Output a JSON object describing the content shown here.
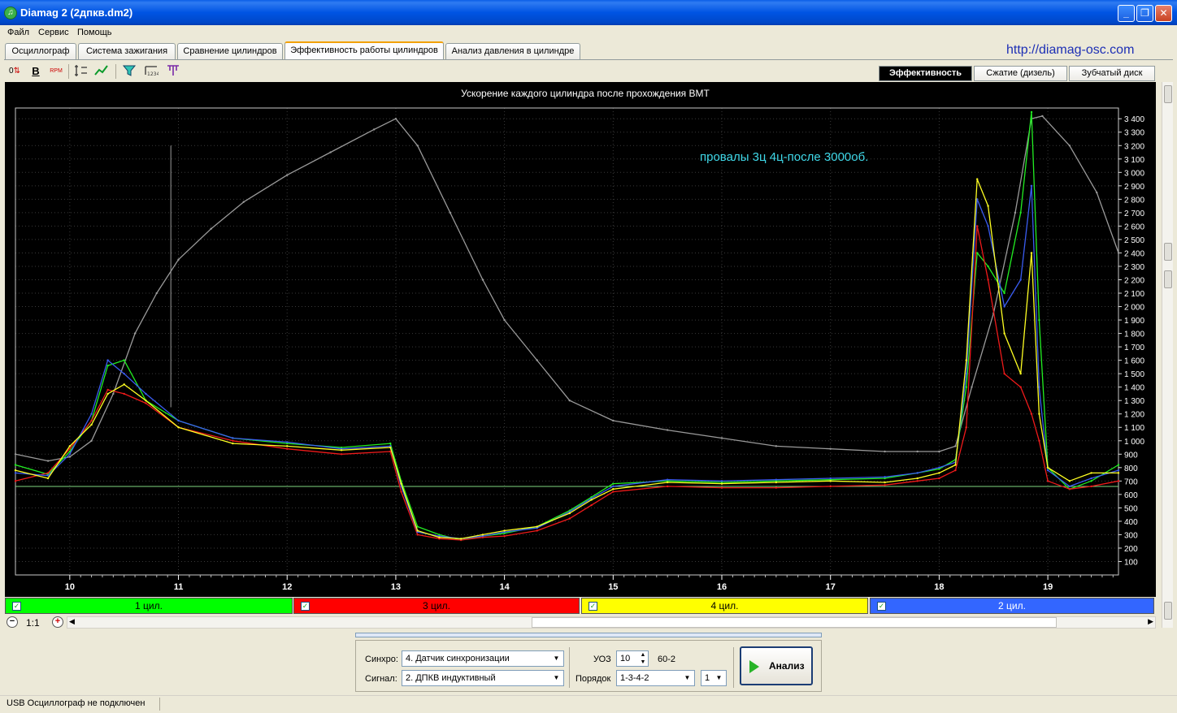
{
  "window": {
    "title": "Diamag 2 (2дпкв.dm2)",
    "site": "http://diamag-osc.com",
    "min": "_",
    "max": "❐",
    "close": "✕"
  },
  "menu": [
    "Файл",
    "Сервис",
    "Помощь"
  ],
  "tabs": [
    "Осциллограф",
    "Система зажигания",
    "Сравнение цилиндров",
    "Эффективность работы цилиндров",
    "Анализ давления в цилиндре"
  ],
  "active_tab": 3,
  "toolbar": {
    "o_button": "0",
    "bold_button": "B",
    "rpm_button": "RPM"
  },
  "subtabs": [
    "Эффективность",
    "Сжатие (дизель)",
    "Зубчатый диск"
  ],
  "active_subtab": 0,
  "chart_data": {
    "type": "line",
    "title": "Ускорение каждого цилиндра после прохождения ВМТ",
    "annotation": "провалы 3ц 4ц-после 3000об.",
    "xlim": [
      9.5,
      19.65
    ],
    "ylim": [
      0,
      3480
    ],
    "x_ticks": [
      "10",
      "11",
      "12",
      "13",
      "14",
      "15",
      "16",
      "17",
      "18",
      "19"
    ],
    "y_ticks": [
      "100",
      "200",
      "300",
      "400",
      "500",
      "600",
      "700",
      "800",
      "900",
      "1 000",
      "1 100",
      "1 200",
      "1 300",
      "1 400",
      "1 500",
      "1 600",
      "1 700",
      "1 800",
      "1 900",
      "2 000",
      "2 100",
      "2 200",
      "2 300",
      "2 400",
      "2 500",
      "2 600",
      "2 700",
      "2 800",
      "2 900",
      "3 000",
      "3 100",
      "3 200",
      "3 300",
      "3 400"
    ],
    "reference_line": 660,
    "colors": {
      "rpm": "#9a9a9a",
      "cyl1": "#22ee22",
      "cyl3": "#ee1a1a",
      "cyl4": "#ffff22",
      "cyl2": "#3a5cf0",
      "annotation": "#3fd8e8"
    },
    "series": [
      {
        "name": "1 цил.",
        "x": [
          9.5,
          9.8,
          10.0,
          10.2,
          10.35,
          10.5,
          10.7,
          11.0,
          11.5,
          12.0,
          12.5,
          12.95,
          13.05,
          13.2,
          13.4,
          13.6,
          13.8,
          14.0,
          14.3,
          14.6,
          14.8,
          15.0,
          15.5,
          16.0,
          16.5,
          17.0,
          17.5,
          17.8,
          18.0,
          18.15,
          18.25,
          18.35,
          18.45,
          18.6,
          18.75,
          18.85,
          18.92,
          19.0,
          19.2,
          19.4,
          19.65
        ],
        "values": [
          820,
          750,
          920,
          1150,
          1560,
          1600,
          1300,
          1150,
          1020,
          980,
          950,
          980,
          700,
          360,
          300,
          260,
          290,
          310,
          360,
          480,
          580,
          680,
          700,
          690,
          700,
          710,
          720,
          760,
          790,
          860,
          1400,
          2400,
          2300,
          2100,
          2700,
          3450,
          1900,
          800,
          640,
          700,
          820
        ]
      },
      {
        "name": "3 цил.",
        "x": [
          9.5,
          9.8,
          10.0,
          10.2,
          10.35,
          10.5,
          10.7,
          11.0,
          11.5,
          12.0,
          12.5,
          12.95,
          13.05,
          13.2,
          13.4,
          13.6,
          13.8,
          14.0,
          14.3,
          14.6,
          14.8,
          15.0,
          15.5,
          16.0,
          16.5,
          17.0,
          17.5,
          17.8,
          18.0,
          18.15,
          18.25,
          18.35,
          18.45,
          18.6,
          18.75,
          18.85,
          18.92,
          19.0,
          19.2,
          19.4,
          19.65
        ],
        "values": [
          700,
          760,
          940,
          1150,
          1380,
          1350,
          1280,
          1100,
          1000,
          940,
          900,
          920,
          620,
          300,
          270,
          260,
          280,
          290,
          330,
          420,
          520,
          620,
          660,
          650,
          650,
          660,
          670,
          700,
          720,
          780,
          1100,
          2600,
          2200,
          1500,
          1400,
          1200,
          1000,
          700,
          640,
          660,
          700
        ]
      },
      {
        "name": "4 цил.",
        "x": [
          9.5,
          9.8,
          10.0,
          10.2,
          10.35,
          10.5,
          10.7,
          11.0,
          11.5,
          12.0,
          12.5,
          12.95,
          13.05,
          13.2,
          13.4,
          13.6,
          13.8,
          14.0,
          14.3,
          14.6,
          14.8,
          15.0,
          15.5,
          16.0,
          16.5,
          17.0,
          17.5,
          17.8,
          18.0,
          18.15,
          18.25,
          18.35,
          18.45,
          18.6,
          18.75,
          18.85,
          18.92,
          19.0,
          19.2,
          19.4,
          19.65
        ],
        "values": [
          780,
          720,
          960,
          1120,
          1350,
          1420,
          1300,
          1100,
          980,
          960,
          930,
          950,
          680,
          330,
          280,
          270,
          300,
          330,
          360,
          460,
          560,
          640,
          690,
          680,
          690,
          700,
          690,
          720,
          760,
          820,
          1600,
          2950,
          2750,
          1800,
          1500,
          2400,
          1200,
          800,
          700,
          760,
          760
        ]
      },
      {
        "name": "2 цил.",
        "x": [
          9.5,
          9.8,
          10.0,
          10.2,
          10.35,
          10.5,
          10.7,
          11.0,
          11.5,
          12.0,
          12.5,
          12.95,
          13.05,
          13.2,
          13.4,
          13.6,
          13.8,
          14.0,
          14.3,
          14.6,
          14.8,
          15.0,
          15.5,
          16.0,
          16.5,
          17.0,
          17.5,
          17.8,
          18.0,
          18.15,
          18.25,
          18.35,
          18.45,
          18.6,
          18.75,
          18.85,
          18.92,
          19.0,
          19.2,
          19.4,
          19.65
        ],
        "values": [
          760,
          740,
          900,
          1200,
          1600,
          1500,
          1350,
          1150,
          1020,
          990,
          940,
          960,
          660,
          320,
          290,
          270,
          290,
          320,
          350,
          470,
          570,
          660,
          710,
          700,
          710,
          720,
          730,
          760,
          800,
          840,
          1500,
          2800,
          2600,
          2000,
          2200,
          2900,
          1400,
          780,
          660,
          720,
          780
        ]
      },
      {
        "name": "RPM",
        "x": [
          9.5,
          9.8,
          10.0,
          10.2,
          10.4,
          10.6,
          10.8,
          11.0,
          11.3,
          11.6,
          12.0,
          12.4,
          12.8,
          13.0,
          13.2,
          13.5,
          13.8,
          14.0,
          14.3,
          14.6,
          15.0,
          15.5,
          16.0,
          16.5,
          17.0,
          17.5,
          17.8,
          18.0,
          18.15,
          18.3,
          18.5,
          18.7,
          18.85,
          18.95,
          19.2,
          19.45,
          19.65
        ],
        "values": [
          900,
          850,
          880,
          1000,
          1350,
          1800,
          2100,
          2350,
          2580,
          2780,
          2980,
          3150,
          3320,
          3400,
          3200,
          2700,
          2200,
          1900,
          1600,
          1300,
          1150,
          1080,
          1020,
          960,
          940,
          920,
          920,
          920,
          960,
          1400,
          1950,
          2700,
          3400,
          3420,
          3200,
          2850,
          2400
        ]
      }
    ]
  },
  "legend": [
    {
      "label": "1 цил.",
      "color": "#00ff00"
    },
    {
      "label": "3 цил.",
      "color": "#ff0000"
    },
    {
      "label": "4 цил.",
      "color": "#ffff00"
    },
    {
      "label": "2 цил.",
      "color": "#3366ff"
    }
  ],
  "zoom": {
    "label": "1:1",
    "minus": "−",
    "plus": "+"
  },
  "panel": {
    "sync_label": "Синхро:",
    "sync_value": "4.  Датчик синхронизации",
    "signal_label": "Сигнал:",
    "signal_value": "2.  ДПКВ индуктивный",
    "uoz_label": "УОЗ",
    "uoz_value": "10",
    "wheel": "60-2",
    "order_label": "Порядок",
    "order_value": "1-3-4-2",
    "order_index": "1",
    "analyze": "Анализ"
  },
  "status": "USB Осциллограф не подключен"
}
